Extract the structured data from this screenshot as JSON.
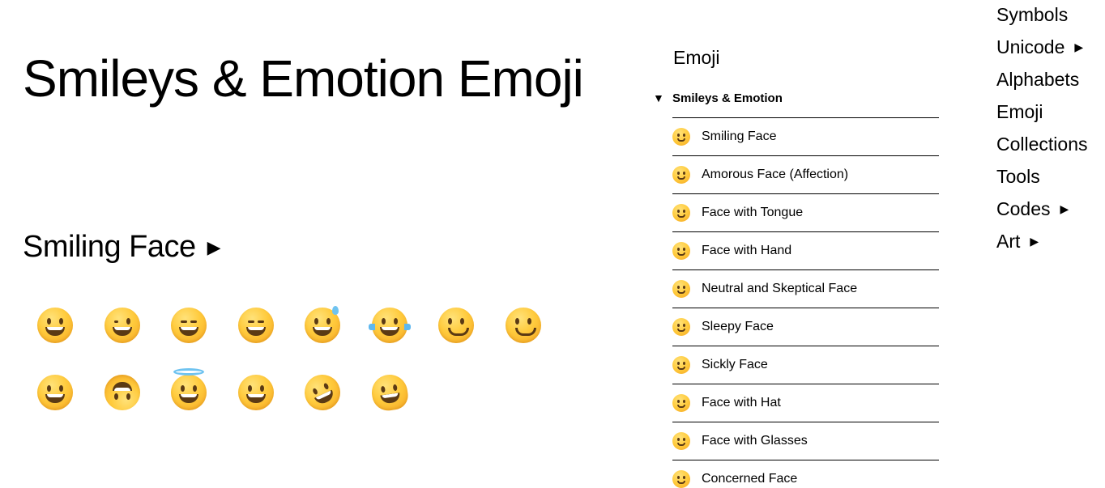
{
  "page": {
    "title": "Smileys & Emotion Emoji",
    "section_heading": "Smiling Face",
    "section_arrow": "▶"
  },
  "emoji_grid": [
    {
      "name": "grinning-face-icon",
      "style": "grin"
    },
    {
      "name": "winking-face-icon",
      "style": "wink"
    },
    {
      "name": "beaming-face-icon",
      "style": "squint"
    },
    {
      "name": "squinting-face-icon",
      "style": "squint"
    },
    {
      "name": "sweat-smile-face-icon",
      "style": "sweat"
    },
    {
      "name": "tears-of-joy-face-icon",
      "style": "tears"
    },
    {
      "name": "smiling-eyes-face-icon",
      "style": "smile"
    },
    {
      "name": "slightly-smiling-face-icon",
      "style": "smile"
    },
    {
      "name": "grinning-smiling-eyes-face-icon",
      "style": "grin"
    },
    {
      "name": "upside-down-face-icon",
      "style": "flip"
    },
    {
      "name": "halo-face-icon",
      "style": "halo"
    },
    {
      "name": "big-eyes-grinning-face-icon",
      "style": "grin"
    },
    {
      "name": "rolling-laughing-face-icon",
      "style": "tilt"
    },
    {
      "name": "melting-face-icon",
      "style": "melt"
    }
  ],
  "category": {
    "title": "Emoji",
    "expanded_marker": "▼",
    "subcategory_title": "Smileys & Emotion",
    "items": [
      {
        "label": "Smiling Face",
        "icon": "tears-of-joy-face-icon"
      },
      {
        "label": "Amorous Face (Affection)",
        "icon": "heart-eyes-face-icon"
      },
      {
        "label": "Face with Tongue",
        "icon": "yum-face-icon"
      },
      {
        "label": "Face with Hand",
        "icon": "thinking-face-icon"
      },
      {
        "label": "Neutral and Skeptical Face",
        "icon": "rolling-eyes-face-icon"
      },
      {
        "label": "Sleepy Face",
        "icon": "pensive-face-icon"
      },
      {
        "label": "Sickly Face",
        "icon": "mask-face-icon"
      },
      {
        "label": "Face with Hat",
        "icon": "cowboy-face-icon"
      },
      {
        "label": "Face with Glasses",
        "icon": "sunglasses-face-icon"
      },
      {
        "label": "Concerned Face",
        "icon": "crying-face-icon"
      }
    ]
  },
  "nav": {
    "items": [
      {
        "label": "Symbols",
        "caret": ""
      },
      {
        "label": "Unicode",
        "caret": "▶"
      },
      {
        "label": "Alphabets",
        "caret": ""
      },
      {
        "label": "Emoji",
        "caret": ""
      },
      {
        "label": "Collections",
        "caret": ""
      },
      {
        "label": "Tools",
        "caret": ""
      },
      {
        "label": "Codes",
        "caret": "▶"
      },
      {
        "label": "Art",
        "caret": "▶"
      }
    ]
  }
}
